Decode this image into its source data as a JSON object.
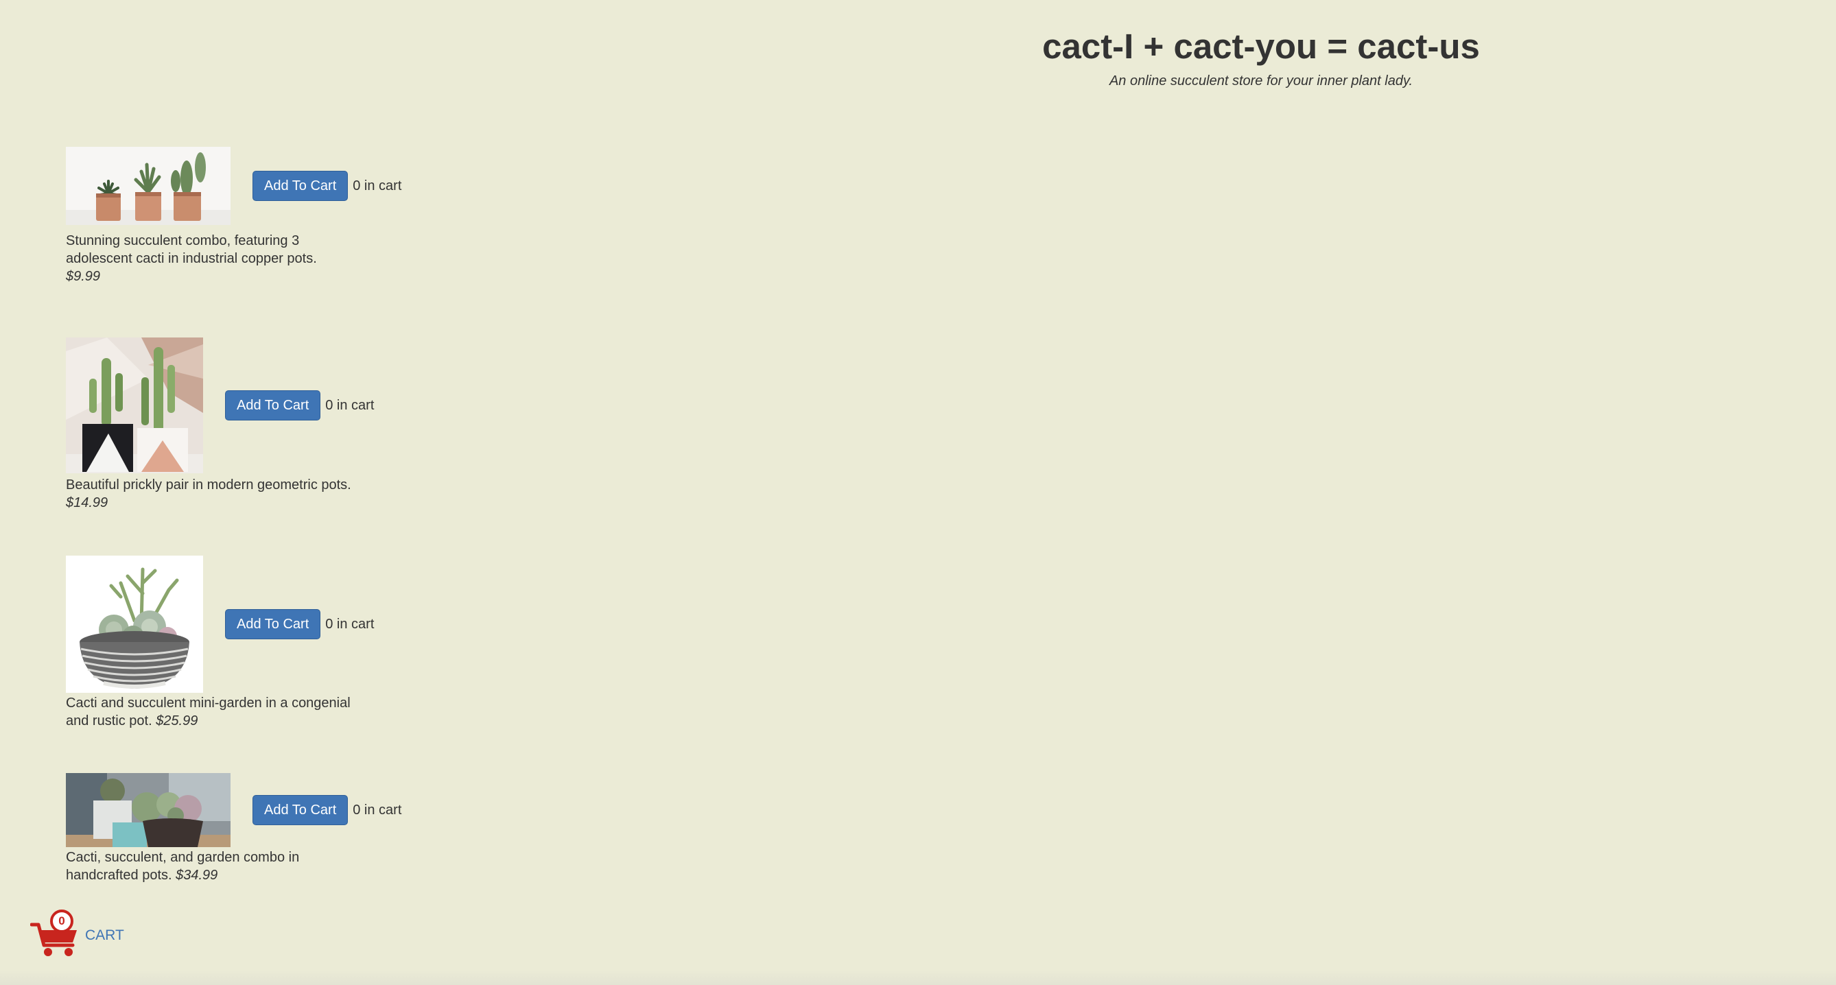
{
  "header": {
    "title": "cact-I + cact-you = cact-us",
    "subtitle": "An online succulent store for your inner plant lady."
  },
  "products": [
    {
      "description": "Stunning succulent combo, featuring 3 adolescent cacti in industrial copper pots.",
      "price": "$9.99",
      "button_label": "Add To Cart",
      "cart_status": "0 in cart"
    },
    {
      "description": "Beautiful prickly pair in modern geometric pots.",
      "price": "$14.99",
      "button_label": "Add To Cart",
      "cart_status": "0 in cart"
    },
    {
      "description": "Cacti and succulent mini-garden in a congenial and rustic pot.",
      "price": "$25.99",
      "button_label": "Add To Cart",
      "cart_status": "0 in cart"
    },
    {
      "description": "Cacti, succulent, and garden combo in handcrafted pots.",
      "price": "$34.99",
      "button_label": "Add To Cart",
      "cart_status": "0 in cart"
    }
  ],
  "cart": {
    "count": "0",
    "label": "CART",
    "icon": "shopping-cart-icon"
  },
  "colors": {
    "background": "#ebebd6",
    "button": "#3f75b5",
    "cart_red": "#c8251e",
    "text": "#333333"
  }
}
